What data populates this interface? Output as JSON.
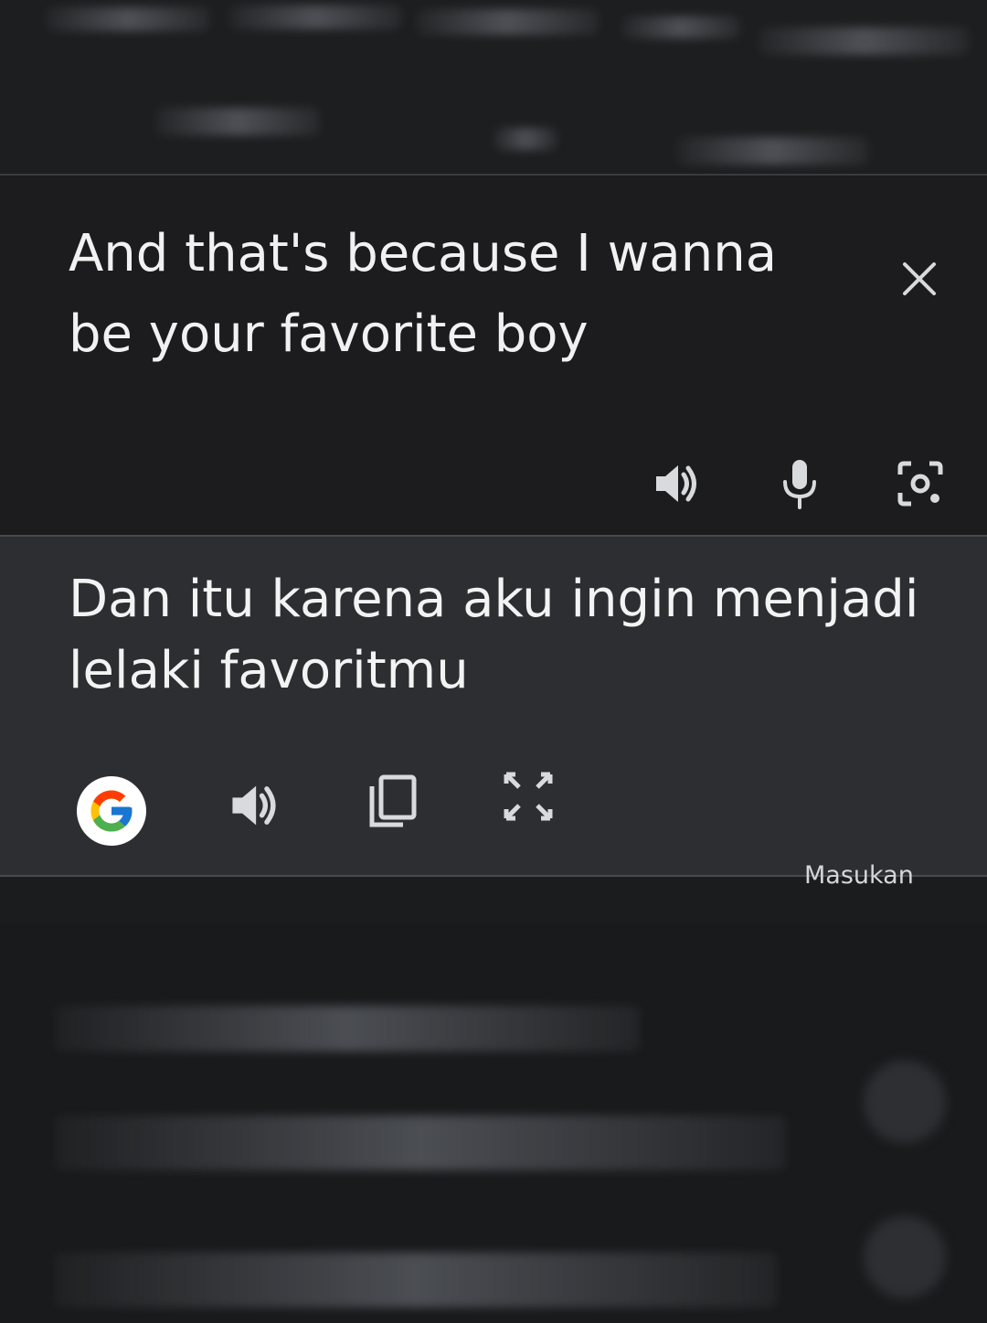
{
  "source": {
    "text": "And that's because I wanna be your favorite boy",
    "close_icon": "close-icon",
    "tools": [
      "speaker-icon",
      "microphone-icon",
      "camera-lens-icon"
    ]
  },
  "translation": {
    "text": "Dan itu karena aku ingin menjadi lelaki favoritmu",
    "tools": [
      "google-logo-icon",
      "speaker-icon",
      "copy-icon",
      "fullscreen-icon"
    ]
  },
  "footer": {
    "feedback_label": "Masukan"
  },
  "colors": {
    "source_bg": "#1c1c1e",
    "target_bg": "#2c2e32",
    "text": "#f1f1f1",
    "icon": "#d8dadd"
  }
}
